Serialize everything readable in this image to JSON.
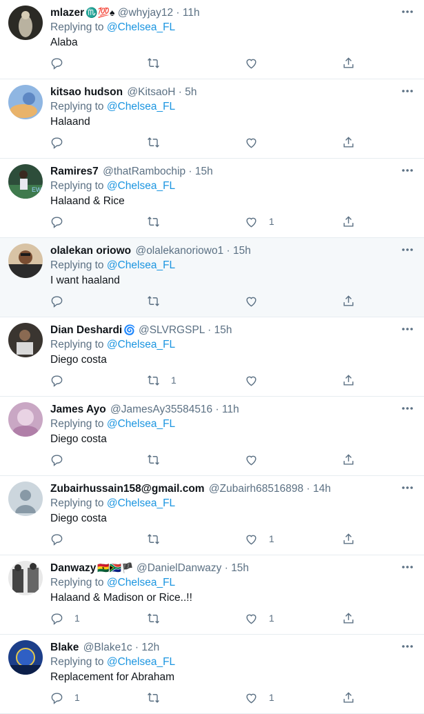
{
  "tweets": [
    {
      "name": "mlazer",
      "badges": "♏💯♠",
      "handle": "@whyjay12",
      "time": "11h",
      "replying_label": "Replying to",
      "replying_to": "@Chelsea_FL",
      "text": "Alaba",
      "replies": "",
      "retweets": "",
      "likes": "",
      "avatar_color": "#2b2a25"
    },
    {
      "name": "kitsao hudson",
      "badges": "",
      "handle": "@KitsaoH",
      "time": "5h",
      "replying_label": "Replying to",
      "replying_to": "@Chelsea_FL",
      "text": "Halaand",
      "replies": "",
      "retweets": "",
      "likes": "",
      "avatar_color": "#6f9fd6"
    },
    {
      "name": "Ramires7",
      "badges": "",
      "handle": "@thatRambochip",
      "time": "15h",
      "replying_label": "Replying to",
      "replying_to": "@Chelsea_FL",
      "text": "Halaand & Rice",
      "replies": "",
      "retweets": "",
      "likes": "1",
      "avatar_color": "#2d4d3a"
    },
    {
      "name": "olalekan oriowo",
      "badges": "",
      "handle": "@olalekanoriowo1",
      "time": "15h",
      "replying_label": "Replying to",
      "replying_to": "@Chelsea_FL",
      "text": "I want haaland",
      "replies": "",
      "retweets": "",
      "likes": "",
      "avatar_color": "#caa78a"
    },
    {
      "name": "Dian Deshardi",
      "badges": "🌀",
      "handle": "@SLVRGSPL",
      "time": "15h",
      "replying_label": "Replying to",
      "replying_to": "@Chelsea_FL",
      "text": "Diego costa",
      "replies": "",
      "retweets": "1",
      "likes": "",
      "avatar_color": "#3a3530"
    },
    {
      "name": "James Ayo",
      "badges": "",
      "handle": "@JamesAy35584516",
      "time": "11h",
      "replying_label": "Replying to",
      "replying_to": "@Chelsea_FL",
      "text": "Diego costa",
      "replies": "",
      "retweets": "",
      "likes": "",
      "avatar_color": "#c9a7c4"
    },
    {
      "name": "Zubairhussain158@gmail.com",
      "badges": "",
      "handle": "@Zubairh68516898",
      "time": "14h",
      "replying_label": "Replying to",
      "replying_to": "@Chelsea_FL",
      "text": "Diego costa",
      "replies": "",
      "retweets": "",
      "likes": "1",
      "avatar_color": "#ccd6dd"
    },
    {
      "name": "Danwazy",
      "badges": "🇬🇭🇿🇦🏴",
      "handle": "@DanielDanwazy",
      "time": "15h",
      "replying_label": "Replying to",
      "replying_to": "@Chelsea_FL",
      "text": "Halaand & Madison or Rice..!!",
      "replies": "1",
      "retweets": "",
      "likes": "1",
      "avatar_color": "#555555"
    },
    {
      "name": "Blake",
      "badges": "",
      "handle": "@Blake1c",
      "time": "12h",
      "replying_label": "Replying to",
      "replying_to": "@Chelsea_FL",
      "text": "Replacement for Abraham",
      "replies": "1",
      "retweets": "",
      "likes": "1",
      "avatar_color": "#1d3f8a"
    }
  ],
  "icons": {
    "reply": "reply-icon",
    "retweet": "retweet-icon",
    "like": "like-icon",
    "share": "share-icon",
    "more": "more-icon"
  },
  "colors": {
    "mention": "#1b95e0",
    "secondary": "#5b7083",
    "highlight": "#f5f8fa"
  }
}
